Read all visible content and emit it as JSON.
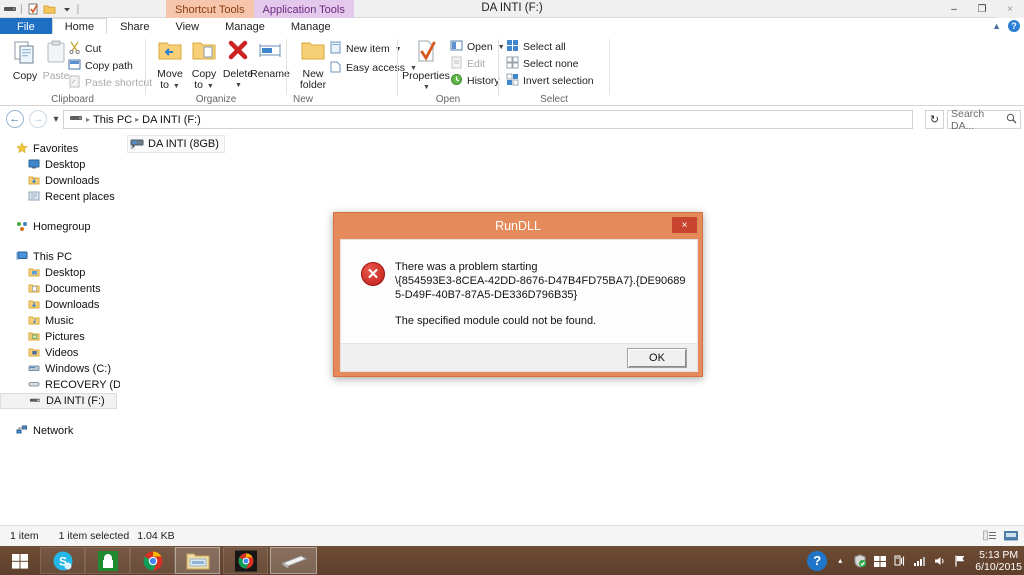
{
  "window": {
    "title": "DA INTI (F:)",
    "caption_buttons": [
      {
        "name": "minimize",
        "glyph": "–"
      },
      {
        "name": "restore",
        "glyph": "❐"
      },
      {
        "name": "close",
        "glyph": "×"
      }
    ],
    "quick_access": [
      "drive-icon",
      "properties-icon",
      "new-folder-icon",
      "customize-caret"
    ]
  },
  "contextual_tabs": [
    {
      "label": "Shortcut Tools",
      "color": "#f6c5ab"
    },
    {
      "label": "Application Tools",
      "color": "#e4c9ec"
    }
  ],
  "tabs": [
    {
      "label": "File",
      "type": "file"
    },
    {
      "label": "Home",
      "type": "active"
    },
    {
      "label": "Share",
      "type": "normal"
    },
    {
      "label": "View",
      "type": "normal"
    },
    {
      "label": "Manage",
      "type": "contextual-shortcut"
    },
    {
      "label": "Manage",
      "type": "contextual-app"
    }
  ],
  "ribbon_controls": {
    "collapse_icon": "chevron-up-icon",
    "help_icon": "help-icon",
    "help_glyph": "?"
  },
  "ribbon": {
    "groups": [
      {
        "name": "Clipboard",
        "label": "Clipboard",
        "big_buttons": [
          {
            "label": "Copy",
            "icon": "copy-icon",
            "disabled": false
          },
          {
            "label": "Paste",
            "icon": "paste-icon",
            "disabled": true
          }
        ],
        "small_buttons": [
          {
            "label": "Cut",
            "icon": "cut-icon",
            "disabled": false
          },
          {
            "label": "Copy path",
            "icon": "copy-path-icon",
            "disabled": false
          },
          {
            "label": "Paste shortcut",
            "icon": "paste-shortcut-icon",
            "disabled": true
          }
        ]
      },
      {
        "name": "Organize",
        "label": "Organize",
        "big_buttons": [
          {
            "label": "Move to",
            "icon": "move-to-icon",
            "dropdown": true
          },
          {
            "label": "Copy to",
            "icon": "copy-to-icon",
            "dropdown": true
          },
          {
            "label": "Delete",
            "icon": "delete-icon",
            "dropdown": true
          },
          {
            "label": "Rename",
            "icon": "rename-icon",
            "dropdown": false
          }
        ]
      },
      {
        "name": "New",
        "label": "New",
        "big_buttons": [
          {
            "label": "New folder",
            "icon": "new-folder-icon",
            "dropdown": false
          }
        ],
        "small_buttons": [
          {
            "label": "New item",
            "icon": "new-item-icon",
            "dropdown": true
          },
          {
            "label": "Easy access",
            "icon": "easy-access-icon",
            "dropdown": true
          }
        ]
      },
      {
        "name": "Open",
        "label": "Open",
        "big_buttons": [
          {
            "label": "Properties",
            "icon": "properties-icon",
            "dropdown": true
          }
        ],
        "small_buttons": [
          {
            "label": "Open",
            "icon": "open-icon",
            "dropdown": true,
            "disabled": false
          },
          {
            "label": "Edit",
            "icon": "edit-icon",
            "disabled": true
          },
          {
            "label": "History",
            "icon": "history-icon",
            "disabled": false
          }
        ]
      },
      {
        "name": "Select",
        "label": "Select",
        "small_buttons": [
          {
            "label": "Select all",
            "icon": "select-all-icon"
          },
          {
            "label": "Select none",
            "icon": "select-none-icon"
          },
          {
            "label": "Invert selection",
            "icon": "invert-selection-icon"
          }
        ]
      }
    ]
  },
  "address_bar": {
    "back_glyph": "←",
    "forward_glyph": "→",
    "recent_glyph": "▾",
    "up_glyph": "↑",
    "breadcrumb": [
      "This PC",
      "DA INTI (F:)"
    ],
    "breadcrumb_sep": "▸",
    "dropdown_glyph": "⌄",
    "refresh_glyph": "↻",
    "search_placeholder": "Search DA...",
    "search_icon": "search-icon"
  },
  "nav_pane": {
    "sections": [
      {
        "root": {
          "label": "Favorites",
          "icon": "star-icon"
        },
        "children": [
          {
            "label": "Desktop",
            "icon": "desktop-icon"
          },
          {
            "label": "Downloads",
            "icon": "downloads-icon"
          },
          {
            "label": "Recent places",
            "icon": "recent-places-icon"
          }
        ]
      },
      {
        "root": {
          "label": "Homegroup",
          "icon": "homegroup-icon"
        },
        "children": []
      },
      {
        "root": {
          "label": "This PC",
          "icon": "this-pc-icon"
        },
        "children": [
          {
            "label": "Desktop",
            "icon": "desktop-folder-icon"
          },
          {
            "label": "Documents",
            "icon": "documents-icon"
          },
          {
            "label": "Downloads",
            "icon": "downloads-icon"
          },
          {
            "label": "Music",
            "icon": "music-icon"
          },
          {
            "label": "Pictures",
            "icon": "pictures-icon"
          },
          {
            "label": "Videos",
            "icon": "videos-icon"
          },
          {
            "label": "Windows (C:)",
            "icon": "hard-drive-icon"
          },
          {
            "label": "RECOVERY (D:)",
            "icon": "drive-icon"
          },
          {
            "label": "DA INTI (F:)",
            "icon": "usb-drive-icon",
            "selected": true
          }
        ]
      },
      {
        "root": {
          "label": "Network",
          "icon": "network-icon"
        },
        "children": []
      }
    ]
  },
  "content": {
    "items": [
      {
        "label": "DA INTI (8GB)",
        "icon": "shortcut-drive-icon",
        "selected": true
      }
    ]
  },
  "dialog": {
    "title": "RunDLL",
    "close_glyph": "×",
    "error_icon": "error-icon",
    "error_glyph": "✕",
    "line1": "There was a problem starting",
    "line2": "\\{854593E3-8CEA-42DD-8676-D47B4FD75BA7}.{DE906895-D49F-40B7-87A5-DE336D796B35}",
    "line3": "The specified module could not be found.",
    "ok_label": "OK",
    "titlebar_color": "#e58a5a",
    "close_color": "#c9442f"
  },
  "status_bar": {
    "item_count": "1 item",
    "selection": "1 item selected",
    "size": "1.04 KB",
    "view_details_icon": "details-view-icon",
    "view_icons_icon": "large-icons-view-icon"
  },
  "taskbar": {
    "start_icon": "windows-start-icon",
    "items": [
      {
        "name": "skype-taskbar-icon",
        "active": false
      },
      {
        "name": "store-taskbar-icon",
        "active": false
      },
      {
        "name": "chrome-taskbar-icon",
        "active": false
      },
      {
        "name": "file-explorer-taskbar-icon",
        "active": true
      },
      {
        "name": "chrome-dark-taskbar-icon",
        "active": false
      },
      {
        "name": "usb-drive-taskbar-icon",
        "active": true
      }
    ],
    "tray": {
      "help_glyph": "?",
      "expand_glyph": "▴",
      "icons": [
        "security-shield-icon",
        "windows-tray-icon",
        "network-icon",
        "signal-icon",
        "volume-icon",
        "action-center-icon"
      ],
      "time": "5:13 PM",
      "date": "6/10/2015"
    }
  }
}
